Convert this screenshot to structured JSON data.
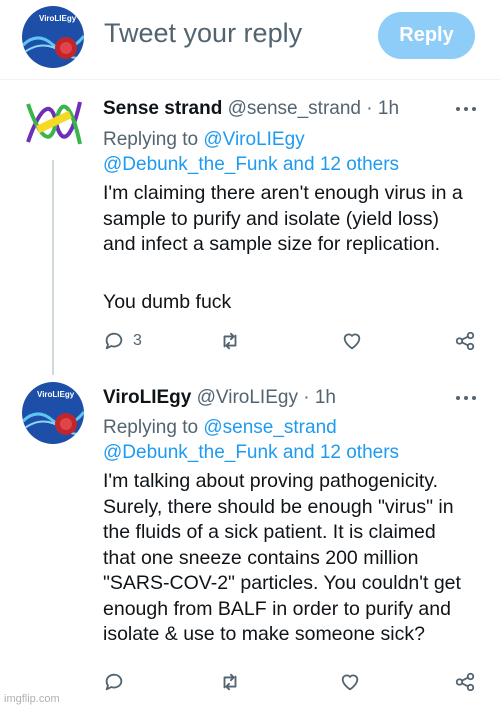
{
  "compose": {
    "placeholder": "Tweet your reply",
    "reply_label": "Reply",
    "avatar_text": "ViroLIEgy"
  },
  "tweets": [
    {
      "name": "Sense strand",
      "handle": "@sense_strand",
      "separator": "·",
      "time": "1h",
      "replying_prefix": "Replying to",
      "replying_to": "@ViroLIEgy",
      "replying_line2": "@Debunk_the_Funk and 12 others",
      "body": [
        "I'm claiming there aren't enough virus in a",
        "sample to purify and isolate (yield loss)",
        "and infect a sample size for replication.",
        "",
        "You dumb fuck"
      ],
      "reply_count": "3",
      "retweet_count": "",
      "like_count": ""
    },
    {
      "name": "ViroLIEgy",
      "handle": "@ViroLIEgy",
      "separator": "·",
      "time": "1h",
      "replying_prefix": "Replying to",
      "replying_to": "@sense_strand",
      "replying_line2": "@Debunk_the_Funk and 12 others",
      "avatar_text": "ViroLIEgy",
      "body": [
        "I'm talking about proving pathogenicity.",
        "Surely, there should be enough \"virus\" in",
        "the fluids of a sick patient. It is claimed",
        "that one sneeze contains 200 million",
        "\"SARS-COV-2\" particles. You couldn't get",
        "enough from BALF in order to purify and",
        "isolate & use to make someone sick?"
      ],
      "reply_count": "",
      "retweet_count": "",
      "like_count": ""
    }
  ],
  "icons": {
    "reply": "reply-bubble-icon",
    "retweet": "retweet-icon",
    "like": "heart-icon",
    "share": "share-icon",
    "more": "more-dots-icon"
  },
  "colors": {
    "link": "#1d9bf0",
    "muted": "#536471",
    "reply_button": "#8ecdf8"
  },
  "watermark": "imgflip.com"
}
